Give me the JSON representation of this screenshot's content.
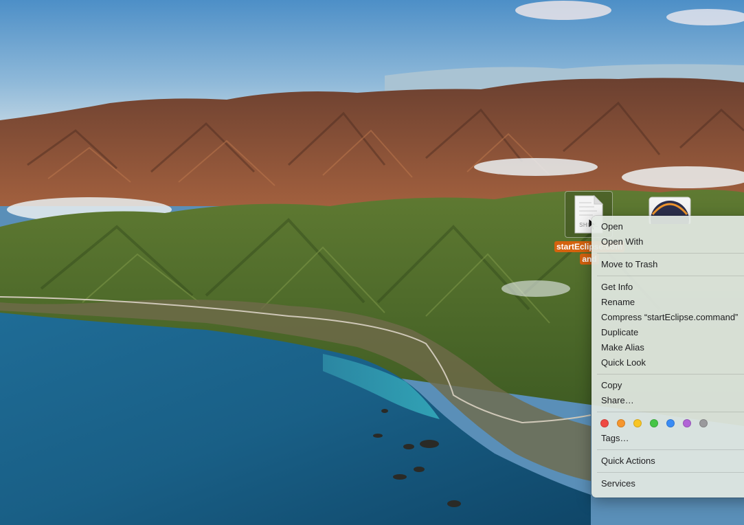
{
  "desktop": {
    "file_icon": {
      "badge": "SHELL",
      "name_line1": "startEclipse.com",
      "name_line2": "and"
    }
  },
  "context_menu": {
    "groups": [
      [
        "Open",
        "Open With"
      ],
      [
        "Move to Trash"
      ],
      [
        "Get Info",
        "Rename",
        "Compress “startEclipse.command”",
        "Duplicate",
        "Make Alias",
        "Quick Look"
      ],
      [
        "Copy",
        "Share…"
      ]
    ],
    "tags": {
      "colors": [
        "#ef4a43",
        "#f6962d",
        "#f8c524",
        "#46c546",
        "#3a8cf5",
        "#b164d6",
        "#9a9a9d"
      ],
      "label": "Tags…"
    },
    "quick_actions": "Quick Actions",
    "services": "Services"
  },
  "colors": {
    "selection_label": "#d4620e",
    "menu_background": "#e2e8e2"
  }
}
